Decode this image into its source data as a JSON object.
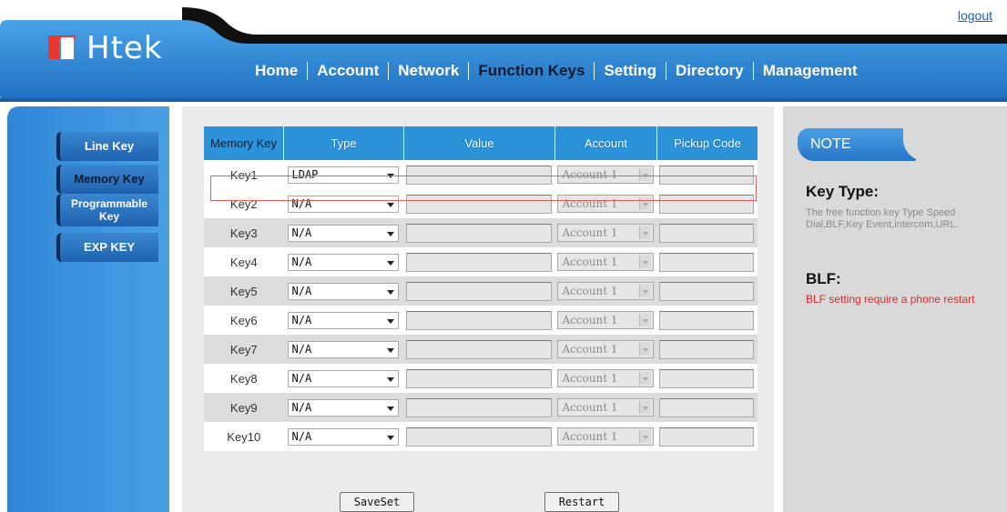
{
  "header": {
    "logo_text": "Htek",
    "logout_label": "logout",
    "nav": [
      {
        "label": "Home"
      },
      {
        "label": "Account"
      },
      {
        "label": "Network"
      },
      {
        "label": "Function Keys",
        "active": true
      },
      {
        "label": "Setting"
      },
      {
        "label": "Directory"
      },
      {
        "label": "Management"
      }
    ]
  },
  "sidebar": {
    "items": [
      {
        "label": "Line Key"
      },
      {
        "label": "Memory Key",
        "active": true
      },
      {
        "label": "Programmable Key"
      },
      {
        "label": "EXP KEY"
      }
    ]
  },
  "table": {
    "headers": [
      "Memory Key",
      "Type",
      "Value",
      "Account",
      "Pickup Code"
    ],
    "rows": [
      {
        "key": "Key1",
        "type": "LDAP",
        "account": "Account 1"
      },
      {
        "key": "Key2",
        "type": "N/A",
        "account": "Account 1"
      },
      {
        "key": "Key3",
        "type": "N/A",
        "account": "Account 1"
      },
      {
        "key": "Key4",
        "type": "N/A",
        "account": "Account 1"
      },
      {
        "key": "Key5",
        "type": "N/A",
        "account": "Account 1"
      },
      {
        "key": "Key6",
        "type": "N/A",
        "account": "Account 1"
      },
      {
        "key": "Key7",
        "type": "N/A",
        "account": "Account 1"
      },
      {
        "key": "Key8",
        "type": "N/A",
        "account": "Account 1"
      },
      {
        "key": "Key9",
        "type": "N/A",
        "account": "Account 1"
      },
      {
        "key": "Key10",
        "type": "N/A",
        "account": "Account 1"
      }
    ],
    "buttons": {
      "saveset": "SaveSet",
      "restart": "Restart"
    }
  },
  "note": {
    "title": "NOTE",
    "key_type_heading": "Key Type:",
    "key_type_text": "The free function key Type Speed Dial,BLF,Key Event,intercom,URL.",
    "blf_heading": "BLF:",
    "blf_text": "BLF setting require a phone restart"
  },
  "colors": {
    "header_blue": "#2a86d4",
    "highlight_border": "#e25c5c",
    "note_red": "#e02828"
  }
}
